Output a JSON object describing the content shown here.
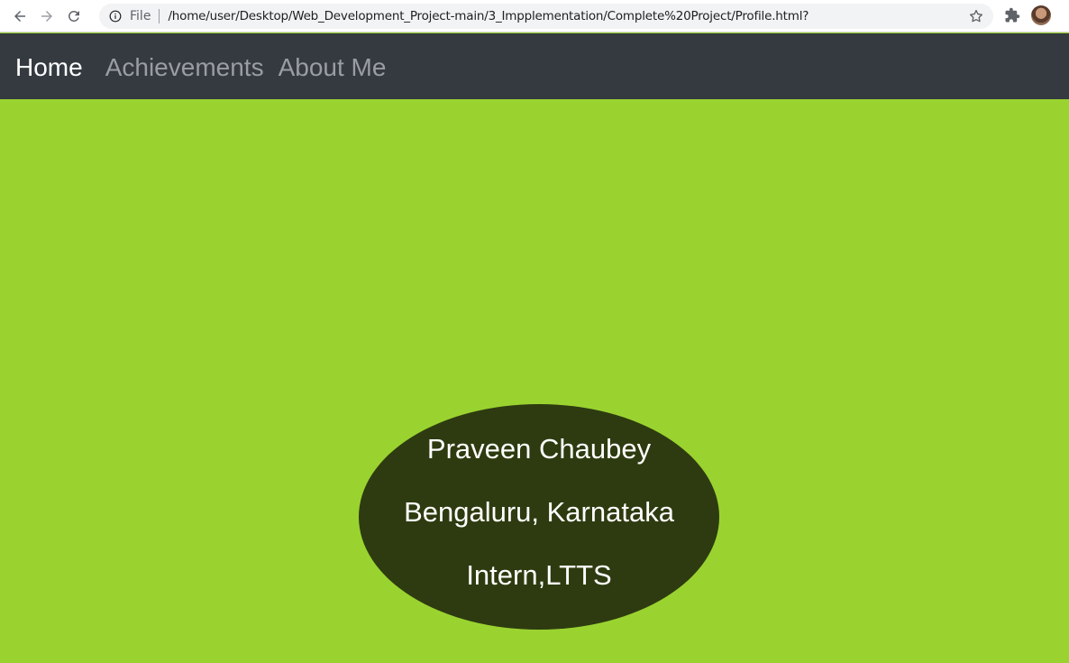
{
  "browser": {
    "scheme_label": "File",
    "url": "/home/user/Desktop/Web_Development_Project-main/3_Impplementation/Complete%20Project/Profile.html?",
    "icons": {
      "back": "arrow-left-icon",
      "forward": "arrow-right-icon",
      "reload": "reload-icon",
      "info": "info-icon",
      "bookmark": "star-icon",
      "extensions": "puzzle-icon",
      "profile": "avatar"
    }
  },
  "nav": {
    "items": [
      {
        "label": "Home",
        "active": true
      },
      {
        "label": "Achievements",
        "active": false
      },
      {
        "label": "About Me",
        "active": false
      }
    ]
  },
  "profile": {
    "name": "Praveen Chaubey",
    "location": "Bengaluru, Karnataka",
    "role": "Intern,LTTS"
  },
  "colors": {
    "page_background": "#9ad330",
    "navbar_background": "#343a40",
    "nav_active": "#ffffff",
    "nav_inactive": "#9a9da1",
    "ellipse_fill": "#2e3b10",
    "ellipse_text": "#ffffff"
  }
}
